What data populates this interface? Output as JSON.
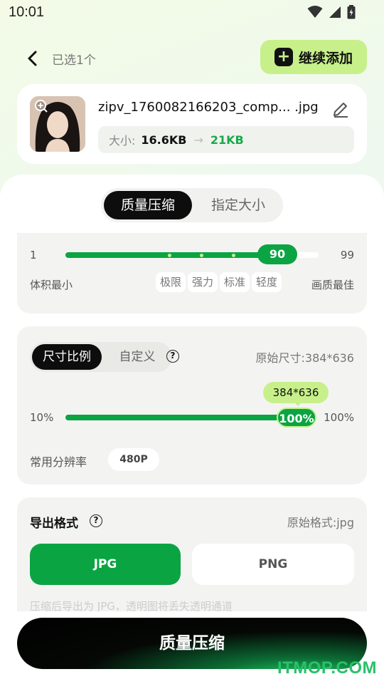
{
  "status_bar": {
    "time": "10:01"
  },
  "header": {
    "title": "已选1个",
    "add_label": "继续添加"
  },
  "file": {
    "name": "zipv_1760082166203_comp... .jpg",
    "size_label": "大小:",
    "original_size": "16.6KB",
    "compressed_size": "21KB"
  },
  "mode_tabs": {
    "active": "质量压缩",
    "inactive": "指定大小"
  },
  "quality": {
    "min": "1",
    "max": "99",
    "value": "90",
    "left_label": "体积最小",
    "right_label": "画质最佳",
    "presets": [
      "极限",
      "强力",
      "标准",
      "轻度"
    ]
  },
  "size_settings": {
    "tab_active": "尺寸比例",
    "tab_inactive": "自定义",
    "original_size": "原始尺寸:384*636",
    "bubble": "384*636",
    "min": "10%",
    "max": "100%",
    "value": "100%",
    "res_label": "常用分辨率",
    "res_chip": "480P"
  },
  "format": {
    "title": "导出格式",
    "original": "原始格式:jpg",
    "options": [
      "JPG",
      "PNG"
    ],
    "note": "压缩后导出为 JPG，透明图将丢失透明通道"
  },
  "compress_button": "质量压缩",
  "watermark": "ITMOP.COM",
  "colors": {
    "accent_green": "#0ba443",
    "lime": "#c7f08a"
  }
}
